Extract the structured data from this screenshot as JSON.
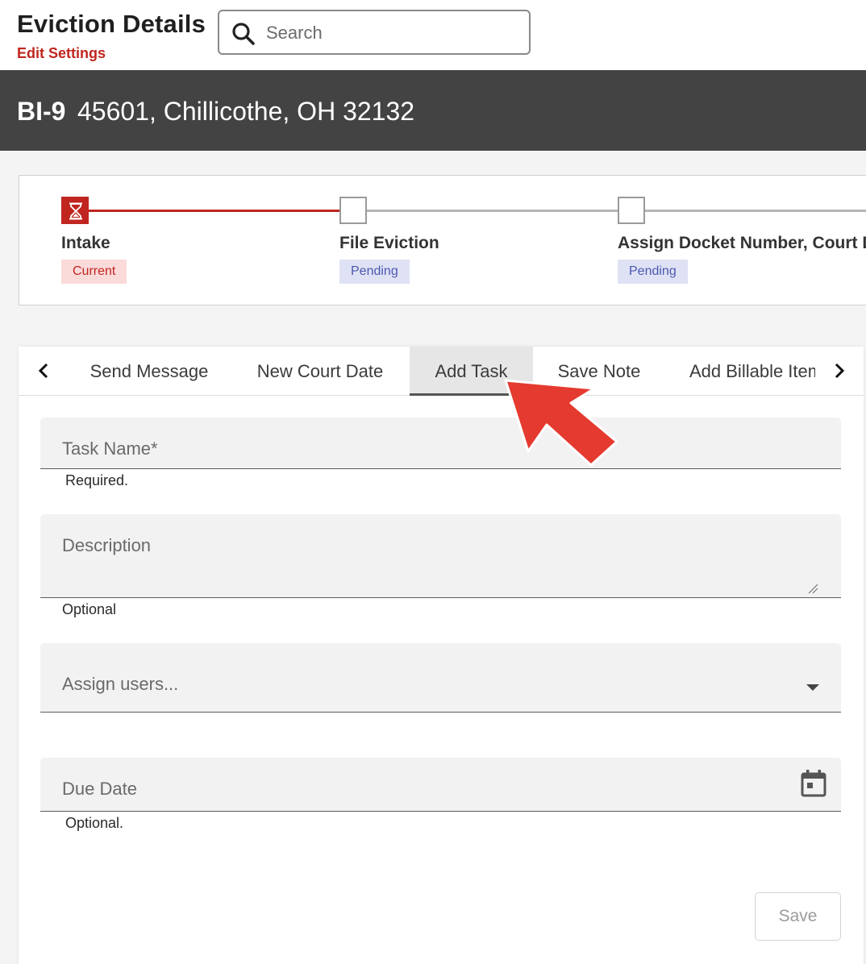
{
  "header": {
    "title": "Eviction Details",
    "edit_link": "Edit Settings",
    "search": {
      "placeholder": "Search",
      "value": ""
    }
  },
  "banner": {
    "id": "BI-9",
    "address": "45601, Chillicothe, OH 32132"
  },
  "stepper": {
    "steps": [
      {
        "label": "Intake",
        "status": "Current"
      },
      {
        "label": "File Eviction",
        "status": "Pending"
      },
      {
        "label": "Assign Docket Number, Court Date",
        "status": "Pending"
      }
    ]
  },
  "tabs": {
    "items": [
      {
        "label": "Send Message",
        "active": false
      },
      {
        "label": "New Court Date",
        "active": false
      },
      {
        "label": "Add Task",
        "active": true
      },
      {
        "label": "Save Note",
        "active": false
      },
      {
        "label": "Add Billable Item",
        "active": false
      }
    ],
    "prev_icon": "chevron-left-icon",
    "next_icon": "chevron-right-icon"
  },
  "form": {
    "task_name": {
      "label": "Task Name*",
      "value": "",
      "helper": "Required."
    },
    "description": {
      "label": "Description",
      "value": "",
      "helper": "Optional"
    },
    "assign_users": {
      "label": "Assign users...",
      "value": ""
    },
    "due_date": {
      "label": "Due Date",
      "value": "",
      "helper": "Optional."
    },
    "save_label": "Save"
  },
  "colors": {
    "brand_red": "#c0261f",
    "banner_bg": "#434343",
    "pending_badge": "#dfe2f4",
    "current_badge": "#fbdada",
    "annotation_arrow": "#e53a2f"
  }
}
